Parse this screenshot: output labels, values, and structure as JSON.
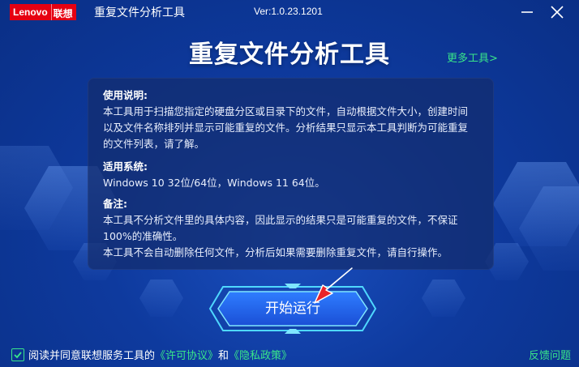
{
  "titlebar": {
    "logo_en": "Lenovo",
    "logo_cn": "联想",
    "app_title": "重复文件分析工具",
    "version": "Ver:1.0.23.1201"
  },
  "header": {
    "title": "重复文件分析工具",
    "more_tools": "更多工具>"
  },
  "info": {
    "usage_heading": "使用说明:",
    "usage_line1": "本工具用于扫描您指定的硬盘分区或目录下的文件，自动根据文件大小，创建时间",
    "usage_line2": "以及文件名称排列并显示可能重复的文件。分析结果只显示本工具判断为可能重复",
    "usage_line3": "的文件列表，请了解。",
    "system_heading": "适用系统:",
    "system_text": "Windows 10 32位/64位，Windows 11 64位。",
    "notes_heading": "备注:",
    "notes_line1": "本工具不分析文件里的具体内容，因此显示的结果只是可能重复的文件，不保证",
    "notes_line2": "100%的准确性。",
    "notes_line3": "本工具不会自动删除任何文件，分析后如果需要删除重复文件，请自行操作。"
  },
  "start_button": "开始运行",
  "footer": {
    "agree_prefix": "阅读并同意联想服务工具的",
    "license_link": "《许可协议》",
    "and": "和",
    "privacy_link": "《隐私政策》",
    "feedback": "反馈问题",
    "agree_checked": true
  },
  "colors": {
    "accent_green": "#39e68a",
    "brand_red": "#e60012",
    "background": "#0e3a9e"
  }
}
